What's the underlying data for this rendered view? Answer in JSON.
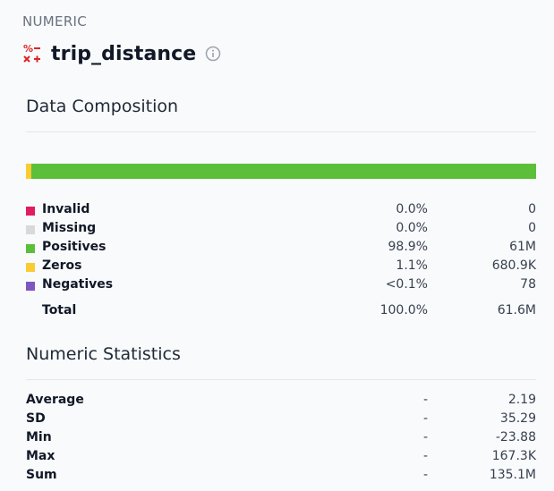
{
  "header": {
    "type_label": "NUMERIC",
    "column_name": "trip_distance",
    "type_icon": "numeric-type-icon",
    "info_icon": "info-icon"
  },
  "composition": {
    "heading": "Data Composition",
    "bar": [
      {
        "name": "Zeros",
        "fraction": 0.011,
        "color": "#facc33"
      },
      {
        "name": "Positives",
        "fraction": 0.989,
        "color": "#5bbf3a"
      }
    ],
    "rows": [
      {
        "label": "Invalid",
        "percent": "0.0%",
        "count": "0",
        "color": "#e11d5f"
      },
      {
        "label": "Missing",
        "percent": "0.0%",
        "count": "0",
        "color": "#d9d9d9"
      },
      {
        "label": "Positives",
        "percent": "98.9%",
        "count": "61M",
        "color": "#5bbf3a"
      },
      {
        "label": "Zeros",
        "percent": "1.1%",
        "count": "680.9K",
        "color": "#facc33"
      },
      {
        "label": "Negatives",
        "percent": "<0.1%",
        "count": "78",
        "color": "#7e57c2"
      }
    ],
    "total": {
      "label": "Total",
      "percent": "100.0%",
      "count": "61.6M"
    }
  },
  "statistics": {
    "heading": "Numeric Statistics",
    "rows": [
      {
        "label": "Average",
        "percent": "-",
        "value": "2.19"
      },
      {
        "label": "SD",
        "percent": "-",
        "value": "35.29"
      },
      {
        "label": "Min",
        "percent": "-",
        "value": "-23.88"
      },
      {
        "label": "Max",
        "percent": "-",
        "value": "167.3K"
      },
      {
        "label": "Sum",
        "percent": "-",
        "value": "135.1M"
      }
    ]
  }
}
